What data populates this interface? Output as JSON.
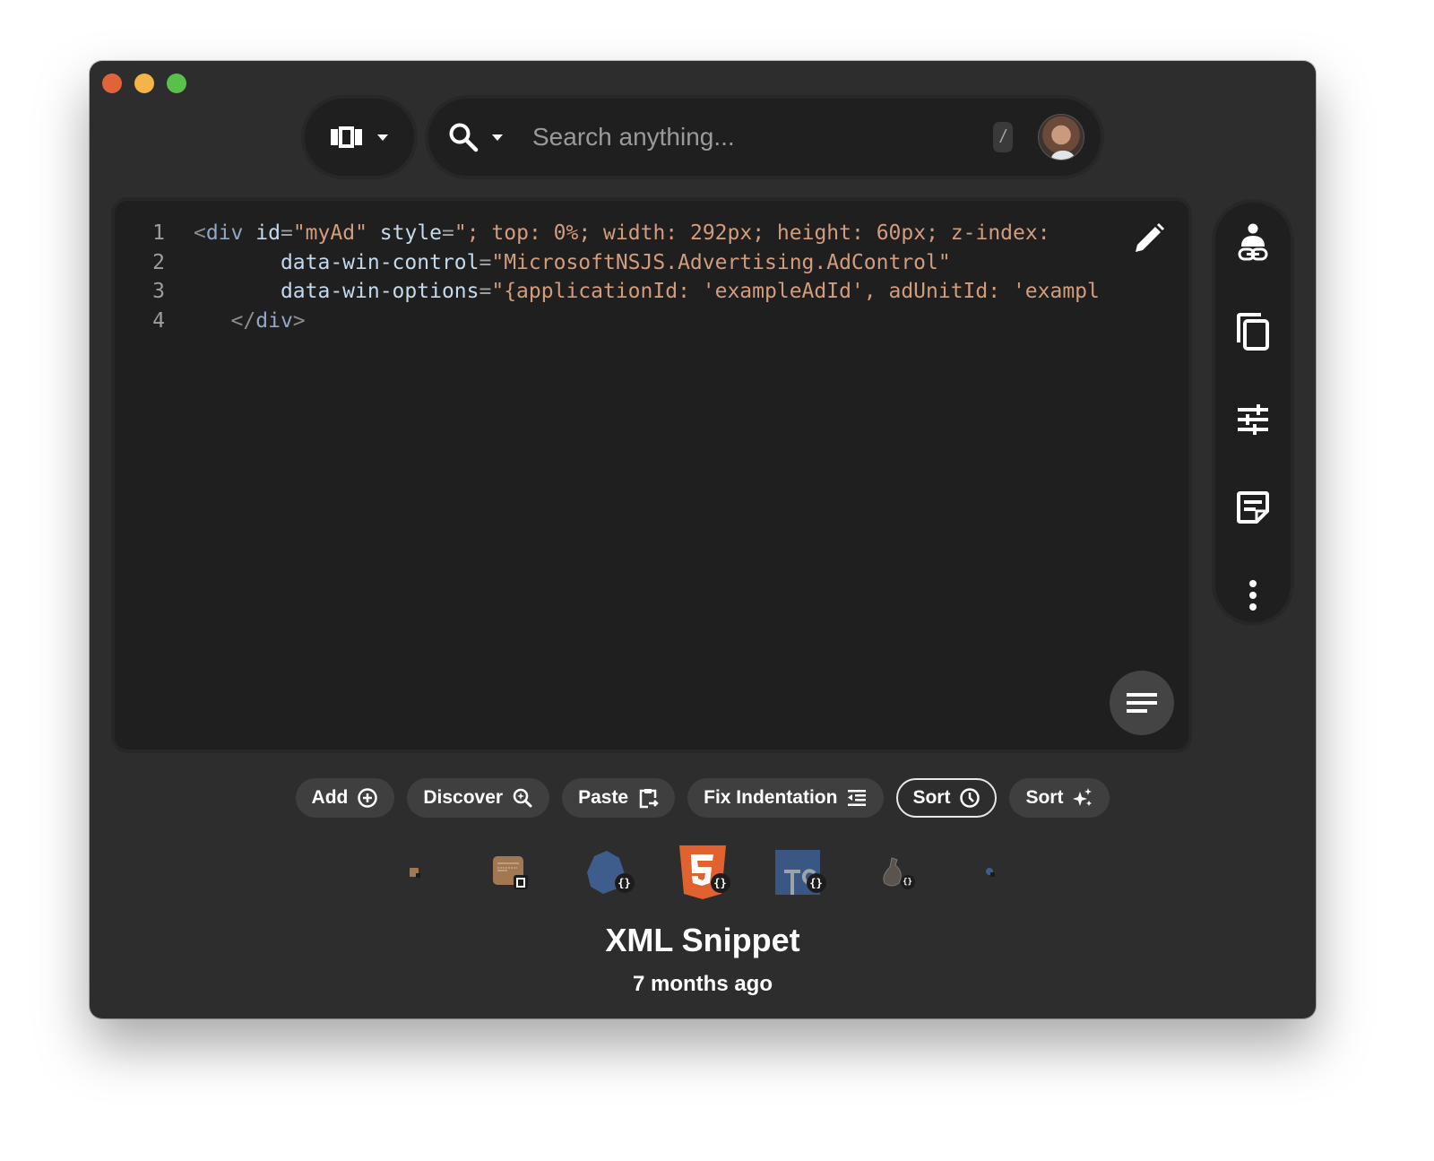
{
  "window": {
    "traffic_lights": [
      "close",
      "minimize",
      "maximize"
    ]
  },
  "toolbar": {
    "view_switcher_icon": "carousel-view-icon",
    "view_dropdown_icon": "caret-down-icon",
    "search_icon": "search-icon",
    "search_dropdown_icon": "caret-down-icon",
    "search_placeholder": "Search anything...",
    "search_value": "",
    "shortcut_key": "/",
    "avatar": "user-avatar"
  },
  "editor": {
    "lines": [
      {
        "number": "1",
        "indent": "",
        "tokens": [
          {
            "t": "<",
            "c": "tag-br"
          },
          {
            "t": "div",
            "c": "tag-nm"
          },
          {
            "t": " ",
            "c": ""
          },
          {
            "t": "id",
            "c": "attr"
          },
          {
            "t": "=",
            "c": "eq"
          },
          {
            "t": "\"myAd\"",
            "c": "str"
          },
          {
            "t": " ",
            "c": ""
          },
          {
            "t": "style",
            "c": "attr"
          },
          {
            "t": "=",
            "c": "eq"
          },
          {
            "t": "\"; top: 0%; width: 292px; height: 60px; z-index:",
            "c": "str"
          }
        ]
      },
      {
        "number": "2",
        "indent": "       ",
        "tokens": [
          {
            "t": "data-win-control",
            "c": "attr"
          },
          {
            "t": "=",
            "c": "eq"
          },
          {
            "t": "\"MicrosoftNSJS.Advertising.AdControl\"",
            "c": "str"
          }
        ]
      },
      {
        "number": "3",
        "indent": "       ",
        "tokens": [
          {
            "t": "data-win-options",
            "c": "attr"
          },
          {
            "t": "=",
            "c": "eq"
          },
          {
            "t": "\"{applicationId: 'exampleAdId', adUnitId: 'exampl",
            "c": "str"
          }
        ]
      },
      {
        "number": "4",
        "indent": "   ",
        "tokens": [
          {
            "t": "</",
            "c": "tag-br"
          },
          {
            "t": "div",
            "c": "tag-nm"
          },
          {
            "t": ">",
            "c": "tag-br"
          }
        ]
      }
    ],
    "edit_icon": "pencil-icon",
    "format_icon": "notes-lines-icon"
  },
  "side_rail": {
    "items": [
      {
        "name": "share-link-person",
        "icon": "person-link-icon"
      },
      {
        "name": "copy",
        "icon": "copy-icon"
      },
      {
        "name": "adjustments",
        "icon": "sliders-icon"
      },
      {
        "name": "notes",
        "icon": "sticky-note-icon"
      },
      {
        "name": "more",
        "icon": "more-vertical-icon"
      }
    ]
  },
  "actions": [
    {
      "label": "Add",
      "icon": "plus-circle-icon",
      "active": false
    },
    {
      "label": "Discover",
      "icon": "zoom-sparkle-icon",
      "active": false
    },
    {
      "label": "Paste",
      "icon": "clipboard-paste-icon",
      "active": false
    },
    {
      "label": "Fix Indentation",
      "icon": "indent-icon",
      "active": false
    },
    {
      "label": "Sort",
      "icon": "clock-icon",
      "active": true
    },
    {
      "label": "Sort",
      "icon": "sparkles-icon",
      "active": false
    }
  ],
  "snippet_strip": [
    {
      "name": "tiny-note-snippet",
      "kind": "note"
    },
    {
      "name": "note-snippet",
      "kind": "note"
    },
    {
      "name": "hexagon-snippet",
      "kind": "code"
    },
    {
      "name": "html5-snippet",
      "kind": "code"
    },
    {
      "name": "typescript-snippet",
      "kind": "code"
    },
    {
      "name": "sack-snippet",
      "kind": "code"
    },
    {
      "name": "tiny-blue-snippet",
      "kind": "code"
    }
  ],
  "selected_snippet": {
    "title": "XML Snippet",
    "time": "7 months ago"
  },
  "colors": {
    "window_bg": "#2d2d2d",
    "panel_bg": "#1f1f1f",
    "string": "#d39c7d",
    "attribute": "#c5d9ec",
    "tag": "#8fa8c4",
    "close": "#e0633a",
    "minimize": "#f4b447",
    "maximize": "#5ac04c"
  }
}
